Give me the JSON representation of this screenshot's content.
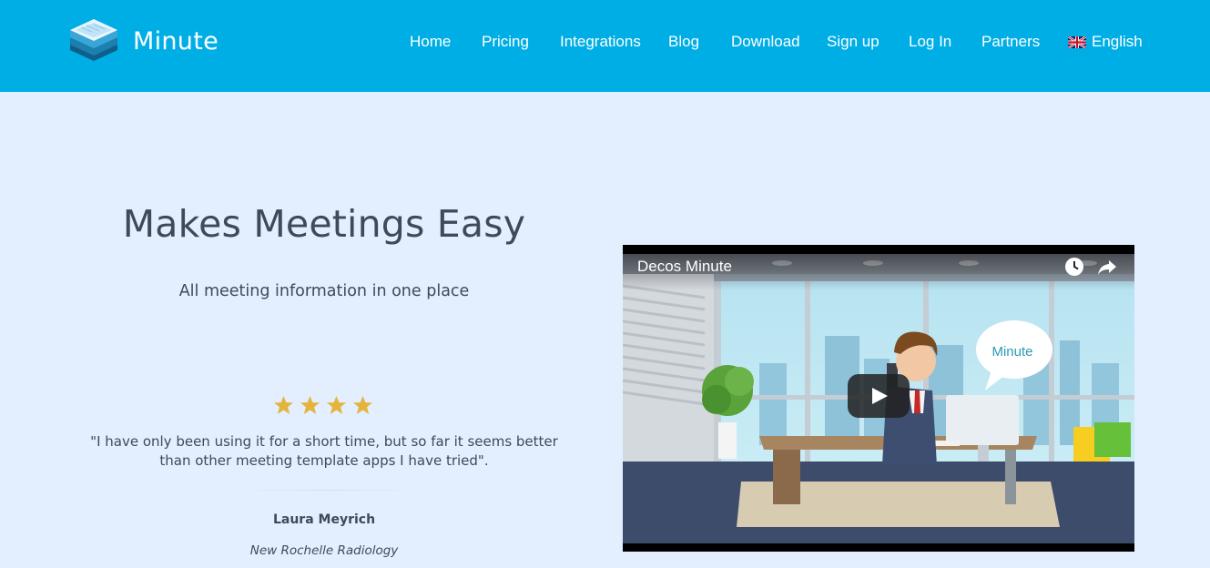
{
  "header": {
    "brand": "Minute",
    "nav": [
      {
        "label": "Home"
      },
      {
        "label": "Pricing"
      },
      {
        "label": "Integrations"
      },
      {
        "label": "Blog"
      },
      {
        "label": "Download"
      },
      {
        "label": "Sign up"
      },
      {
        "label": "Log In"
      },
      {
        "label": "Partners"
      }
    ],
    "language": "English"
  },
  "hero": {
    "title": "Makes Meetings Easy",
    "subtitle": "All meeting information in one place"
  },
  "testimonial": {
    "rating": 4,
    "quote": "\"I have only been using it for a short time, but so far it seems better than other meeting template apps I have tried\".",
    "author": "Laura Meyrich",
    "company": "New Rochelle Radiology"
  },
  "video": {
    "title": "Decos Minute",
    "bubble_text": "Minute"
  },
  "colors": {
    "header_bg": "#00aee6",
    "page_bg": "#e3efff",
    "text": "#3e4a5a",
    "star": "#e4b53e"
  }
}
